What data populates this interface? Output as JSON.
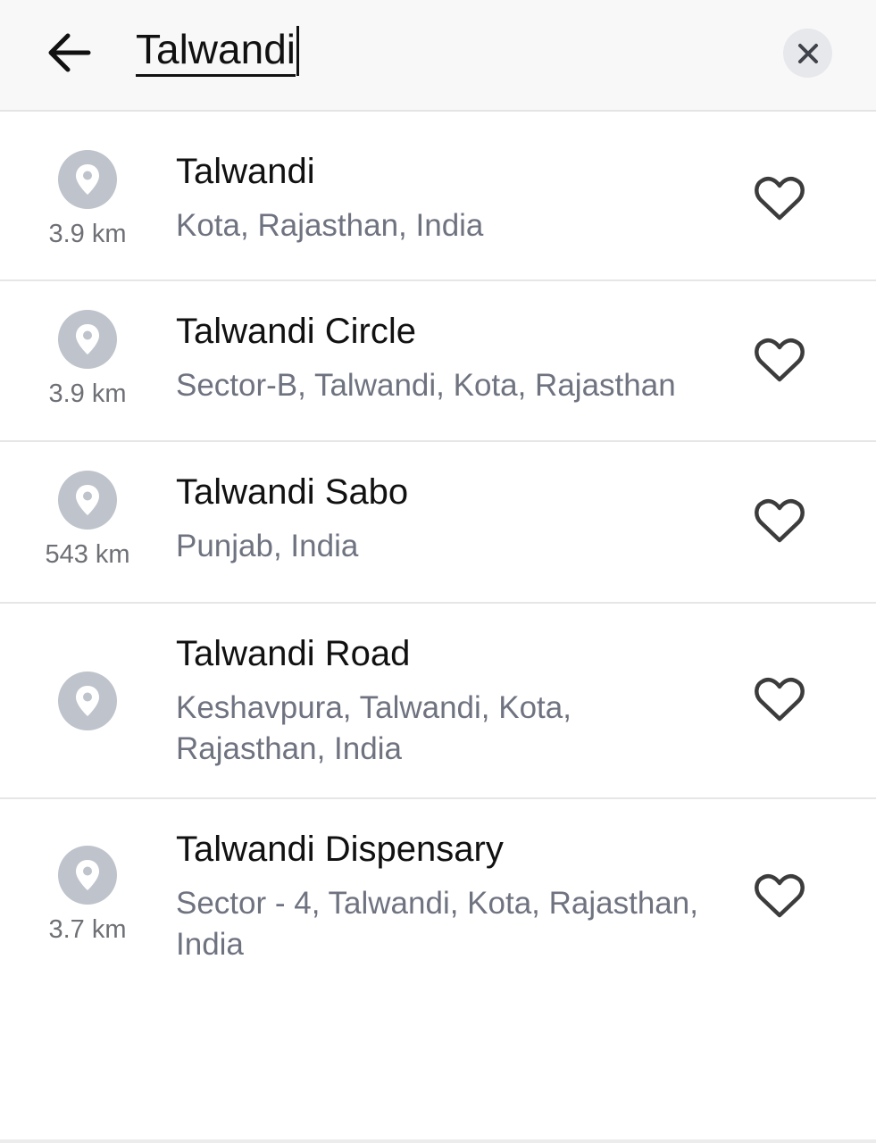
{
  "search": {
    "value": "Talwandi",
    "back_icon": "arrow-left-icon",
    "clear_icon": "close-icon"
  },
  "results": [
    {
      "title": "Talwandi",
      "subtitle": "Kota, Rajasthan, India",
      "distance": "3.9 km"
    },
    {
      "title": "Talwandi Circle",
      "subtitle": "Sector-B, Talwandi, Kota, Rajasthan",
      "distance": "3.9 km"
    },
    {
      "title": "Talwandi Sabo",
      "subtitle": "Punjab, India",
      "distance": "543 km"
    },
    {
      "title": "Talwandi Road",
      "subtitle": "Keshavpura, Talwandi, Kota, Rajasthan, India",
      "distance": ""
    },
    {
      "title": "Talwandi Dispensary",
      "subtitle": "Sector - 4, Talwandi, Kota, Rajasthan, India",
      "distance": "3.7 km"
    }
  ],
  "icons": {
    "pin": "location-pin-icon",
    "favorite": "heart-outline-icon"
  },
  "colors": {
    "pin_bg": "#bfc3cb",
    "subtitle": "#6f7380",
    "distance": "#6e7075"
  }
}
